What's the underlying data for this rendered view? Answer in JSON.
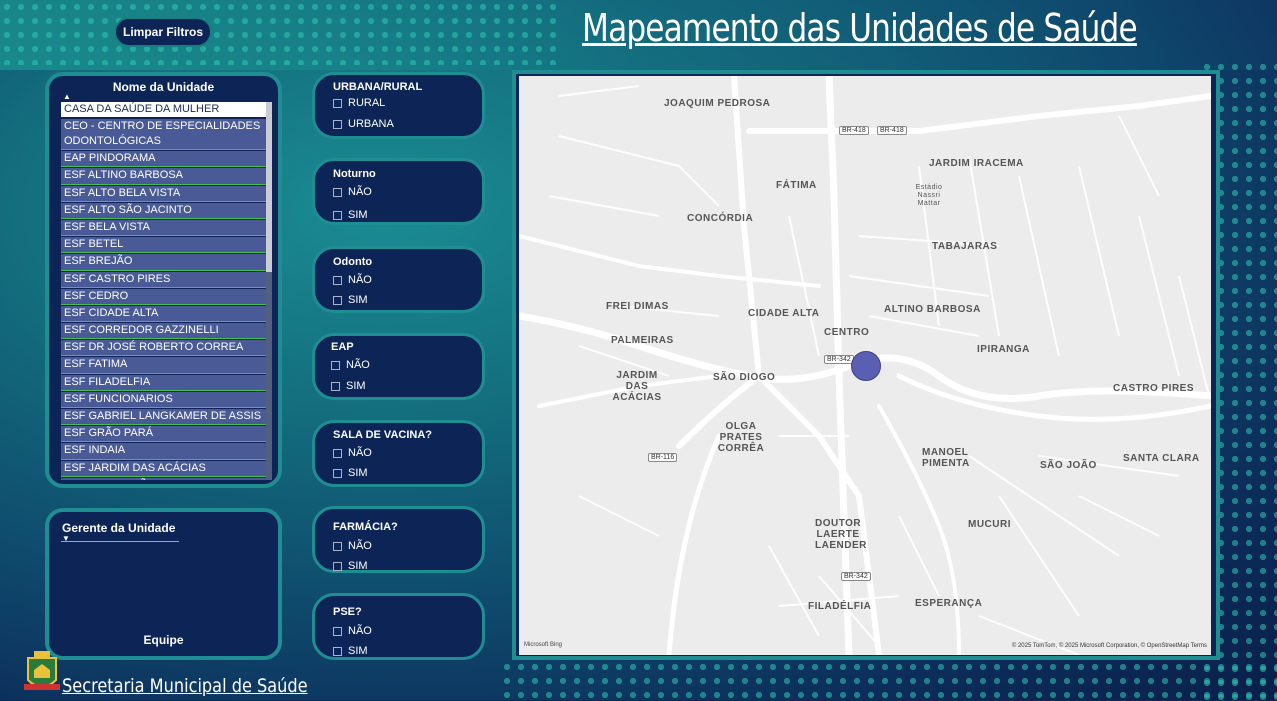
{
  "header": {
    "clear_filters": "Limpar Filtros",
    "title": "Mapeamento das Unidades de Saúde"
  },
  "unit_slicer": {
    "title": "Nome da Unidade",
    "items": [
      "CASA DA SAÚDE DA MULHER",
      "CEO - CENTRO DE ESPECIALIDADES ODONTOLÓGICAS",
      "EAP PINDORAMA",
      "ESF ALTINO BARBOSA",
      "ESF ALTO BELA VISTA",
      "ESF ALTO SÃO JACINTO",
      "ESF BELA VISTA",
      "ESF BETEL",
      "ESF BREJÃO",
      "ESF CASTRO PIRES",
      "ESF CEDRO",
      "ESF CIDADE ALTA",
      "ESF CORREDOR GAZZINELLI",
      "ESF DR JOSÉ ROBERTO CORREA",
      "ESF FATIMA",
      "ESF FILADELFIA",
      "ESF FUNCIONARIOS",
      "ESF GABRIEL LANGKAMER DE ASSIS",
      "ESF GRÃO PARÁ",
      "ESF INDAIA",
      "ESF JARDIM DAS ACÁCIAS",
      "ESF JARDIM SÃO PAULO"
    ]
  },
  "manager_slicer": {
    "title": "Gerente da Unidade",
    "team_label": "Equipe"
  },
  "filters": [
    {
      "title": "URBANA/RURAL",
      "options": [
        "RURAL",
        "URBANA"
      ]
    },
    {
      "title": "Noturno",
      "options": [
        "NÃO",
        "SIM"
      ]
    },
    {
      "title": "Odonto",
      "options": [
        "NÃO",
        "SIM"
      ]
    },
    {
      "title": "EAP",
      "options": [
        "NÃO",
        "SIM"
      ]
    },
    {
      "title": "SALA DE VACINA?",
      "options": [
        "NÃO",
        "SIM"
      ]
    },
    {
      "title": "FARMÁCIA?",
      "options": [
        "NÃO",
        "SIM"
      ]
    },
    {
      "title": "PSE?",
      "options": [
        "NÃO",
        "SIM"
      ]
    }
  ],
  "map": {
    "neighborhoods": {
      "joaquim_pedrosa": "JOAQUIM PEDROSA",
      "fatima": "FÁTIMA",
      "jardim_iracema": "JARDIM IRACEMA",
      "concordia": "CONCÓRDIA",
      "tabajaras": "TABAJARAS",
      "frei_dimas": "FREI DIMAS",
      "cidade_alta": "CIDADE ALTA",
      "altino_barbosa": "ALTINO BARBOSA",
      "palmeiras": "PALMEIRAS",
      "centro": "CENTRO",
      "ipiranga": "IPIRANGA",
      "jardim_acacias": "JARDIM DAS ACÁCIAS",
      "sao_diogo": "SÃO DIOGO",
      "castro_pires": "CASTRO PIRES",
      "olga_prates": "OLGA PRATES CORRÊA",
      "manoel_pimenta": "MANOEL PIMENTA",
      "sao_joao": "SÃO JOÃO",
      "santa_clara": "SANTA CLARA",
      "doutor_laerte": "DOUTOR LAERTE LAENDER",
      "mucuri": "MUCURI",
      "filadelfia": "FILADÉLFIA",
      "esperanca": "ESPERANÇA"
    },
    "stadium": "Estádio Nassri Mattar",
    "shields": {
      "br418a": "BR-418",
      "br418b": "BR-418",
      "br342a": "BR-342",
      "br116": "BR-116",
      "br342b": "BR-342"
    },
    "attribution_left": "Microsoft Bing",
    "attribution_right": "© 2025 TomTom, © 2025 Microsoft Corporation, © OpenStreetMap  Terms"
  },
  "footer": {
    "text": "Secretaria Municipal de Saúde"
  },
  "colors": {
    "accent": "#1f8e93",
    "panel": "#0d2456",
    "marker": "#5a5fb3"
  }
}
